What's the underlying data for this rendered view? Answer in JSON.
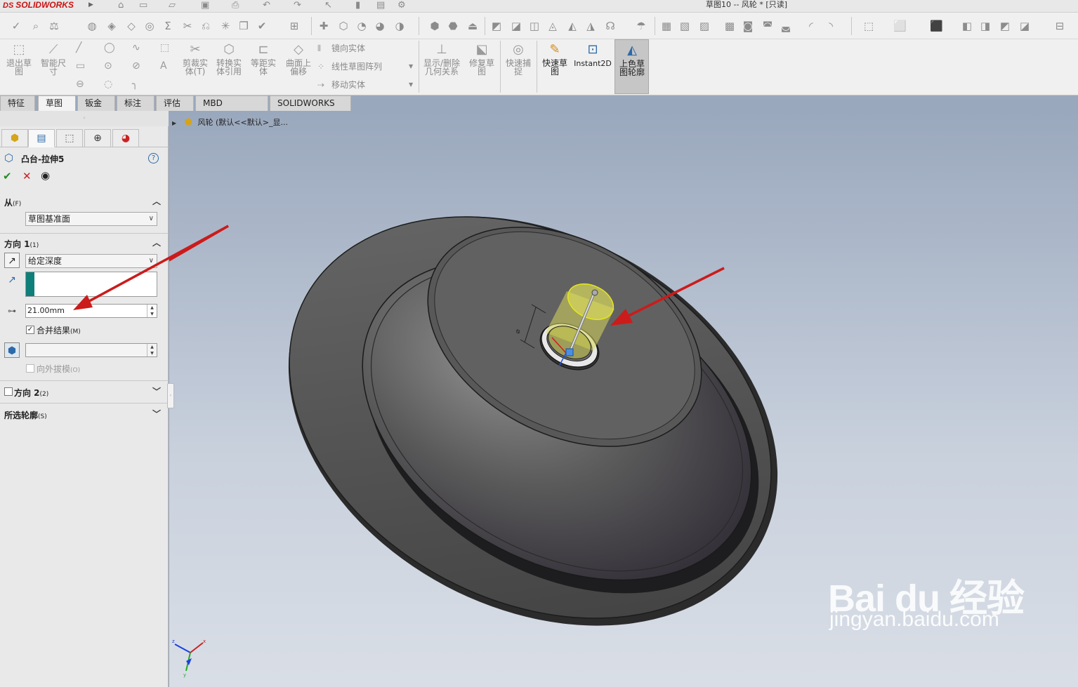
{
  "app": {
    "brand": "SOLIDWORKS",
    "brand_prefix": "DS",
    "window_title": "草图10 -- 风轮 * [只读]"
  },
  "ribbon": {
    "exit_sketch": "退出草图",
    "smart_dim": "智能尺寸",
    "trim": "剪裁实体(T)",
    "convert": "转换实体引用",
    "offset": "等距实体",
    "surface_offset": "曲面上偏移",
    "mirror": "镜向实体",
    "linear_pattern": "线性草图阵列",
    "move": "移动实体",
    "show_relations": "显示/删除几何关系",
    "repair": "修复草图",
    "quick_snap": "快速捕捉",
    "rapid_sketch": "快速草图",
    "instant2d": "Instant2D",
    "shaded_contour": "上色草图轮廓"
  },
  "tabs": [
    {
      "label": "特征"
    },
    {
      "label": "草图"
    },
    {
      "label": "钣金"
    },
    {
      "label": "标注"
    },
    {
      "label": "评估"
    },
    {
      "label": "MBD Dimensions"
    },
    {
      "label": "SOLIDWORKS 插件"
    }
  ],
  "pm": {
    "title": "凸台-拉伸5",
    "from_label": "从",
    "from_key": "(F)",
    "from_value": "草图基准面",
    "dir1_label": "方向 1",
    "dir1_key": "(1)",
    "end_condition": "给定深度",
    "depth": "21.00mm",
    "merge_label": "合并结果",
    "merge_key": "(M)",
    "draft_label": "向外拔模",
    "draft_key": "(O)",
    "dir2_label": "方向 2",
    "dir2_key": "(2)",
    "contours_label": "所选轮廓",
    "contours_key": "(S)"
  },
  "tree": {
    "label": "风轮 (默认<<默认>_显..."
  },
  "watermark": {
    "main": "Bai du 经验",
    "sub": "jingyan.baidu.com"
  },
  "colors": {
    "accent": "#2c6aa8",
    "arrow": "#cc1b1b",
    "preview": "#d9d95c",
    "teal": "#0f7f7a"
  }
}
